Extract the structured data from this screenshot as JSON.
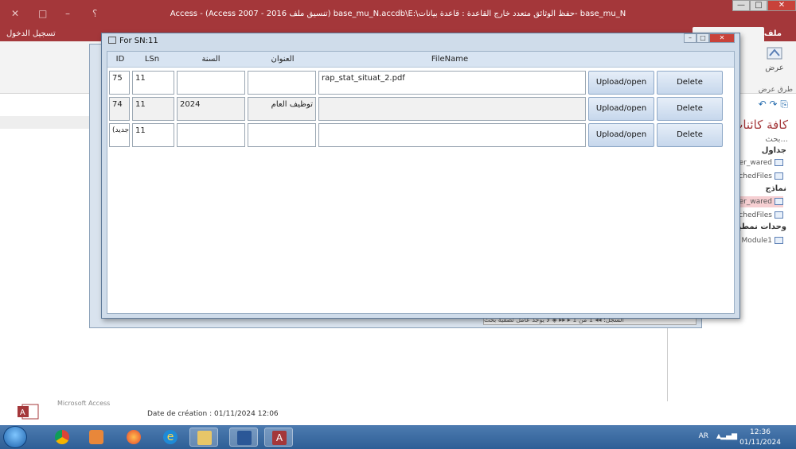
{
  "window": {
    "title": "Access - (Access 2007 - 2016 تنسيق ملف) base_mu_N.accdb\\E:\\حفظ الوثائق متعدد خارج القاعدة : قاعدة بيانات- base_mu_N",
    "minimize": "—",
    "maximize": "□",
    "close": "✕",
    "qat_icons": [
      "✕",
      "□",
      "–",
      "؟"
    ]
  },
  "ribbon": {
    "signin": "تسجيل الدخول",
    "file_tab": "ملف",
    "view_button": "عرض",
    "view_group": "طرق عرض",
    "collapse": "˄"
  },
  "nav_pane": {
    "toolbar": "↶ ↷ ⎘",
    "title": "كافة كائنات",
    "search": "بحث...",
    "groups": {
      "tables": "جداول",
      "forms": "نماذج",
      "modules": "وحدات نمطية"
    },
    "items": [
      {
        "label": "er_wared"
      },
      {
        "label": "chedFiles"
      },
      {
        "label": "er_wared"
      },
      {
        "label": "chedFiles"
      },
      {
        "label": "Module1"
      }
    ]
  },
  "popup": {
    "title": "For SN:11",
    "headers": {
      "id": "ID",
      "lsn": "LSn",
      "year": "السنة",
      "subject": "العنوان",
      "filename": "FileName"
    },
    "rows": [
      {
        "id": "75",
        "lsn": "11",
        "year": "",
        "subject": "",
        "filename": "rap_stat_situat_2.pdf",
        "upload": "Upload/open",
        "delete": "Delete"
      },
      {
        "id": "74",
        "lsn": "11",
        "year": "2024",
        "subject": "توظيف العام",
        "filename": "",
        "upload": "Upload/open",
        "delete": "Delete"
      },
      {
        "id": "(جديد)",
        "lsn": "11",
        "year": "",
        "subject": "",
        "filename": "",
        "upload": "Upload/open",
        "delete": "Delete"
      }
    ]
  },
  "bg_form_nav": "السجل: ◂◂ 1 من 1 ▸ ▸▸ ◈ لا يوجد عامل تصفية بحث",
  "status": {
    "file_type": "Microsoft Access",
    "created": "Date de création : 01/11/2024 12:06"
  },
  "taskbar": {
    "apps": [
      "chrome-icon",
      "media-player-icon",
      "firefox-icon",
      "ie-icon",
      "explorer-icon",
      "word-icon",
      "access-icon"
    ],
    "lang": "AR",
    "arrow": "▲",
    "signal": "▂▄▆",
    "time": "12:36",
    "date": "01/11/2024"
  },
  "colors": {
    "access_red": "#a4373a",
    "form_blue": "#cfdcea",
    "button_blue": "#c6d7ec"
  }
}
